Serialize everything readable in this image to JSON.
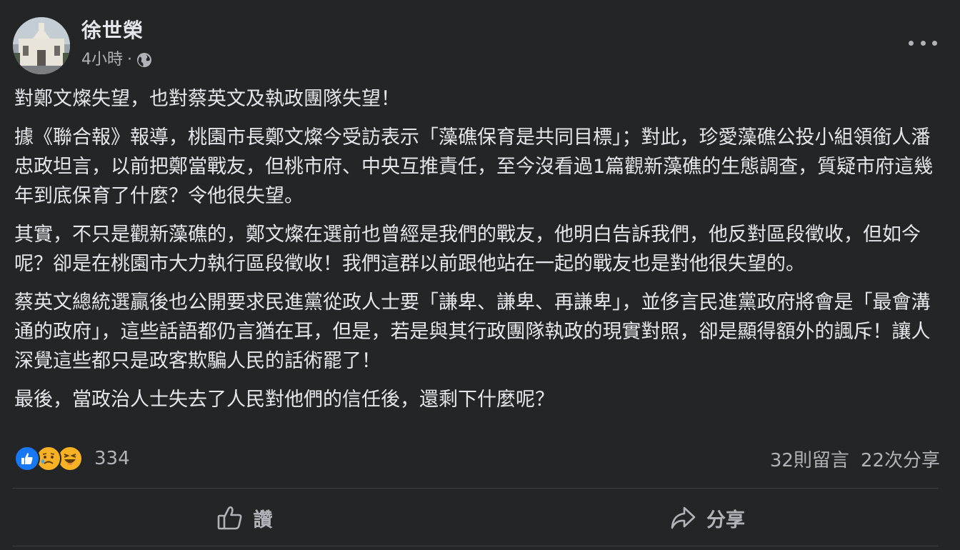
{
  "post": {
    "author": "徐世榮",
    "time": "4小時",
    "separator": "·",
    "privacy_icon": "globe-icon",
    "more_icon": "more-options-icon",
    "paragraphs": [
      "對鄭文燦失望，也對蔡英文及執政團隊失望！",
      "據《聯合報》報導，桃園市長鄭文燦今受訪表示「藻礁保育是共同目標」；對此，珍愛藻礁公投小組領銜人潘忠政坦言，以前把鄭當戰友，但桃市府、中央互推責任，至今沒看過1篇觀新藻礁的生態調查，質疑市府這幾年到底保育了什麼？令他很失望。",
      "其實，不只是觀新藻礁的，鄭文燦在選前也曾經是我們的戰友，他明白告訴我們，他反對區段徵收，但如今呢？卻是在桃園市大力執行區段徵收！我們這群以前跟他站在一起的戰友也是對他很失望的。",
      "蔡英文總統選贏後也公開要求民進黨從政人士要「謙卑、謙卑、再謙卑」，並侈言民進黨政府將會是「最會溝通的政府」，這些話語都仍言猶在耳，但是，若是與其行政團隊執政的現實對照，卻是顯得額外的諷斥！讓人深覺這些都只是政客欺騙人民的話術罷了！",
      "最後，當政治人士失去了人民對他們的信任後，還剩下什麼呢？"
    ]
  },
  "stats": {
    "reactions": [
      "like-icon",
      "sad-icon",
      "haha-icon"
    ],
    "reaction_count": "334",
    "comments": "32則留言",
    "shares": "22次分享"
  },
  "actions": {
    "like_label": "讚",
    "share_label": "分享"
  },
  "colors": {
    "background": "#242526",
    "text_primary": "#e4e6eb",
    "text_secondary": "#b0b3b8",
    "like_blue": "#1877f2",
    "emoji_yellow": "#f7b125"
  }
}
